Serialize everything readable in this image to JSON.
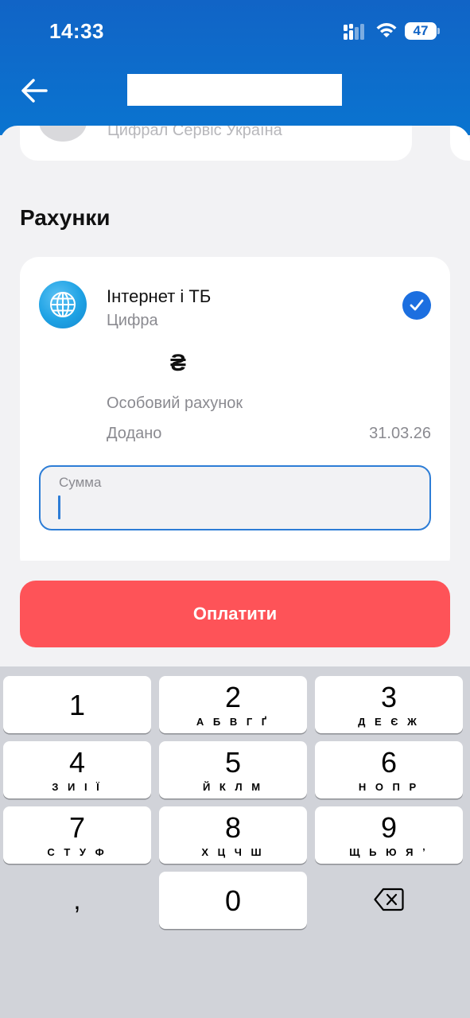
{
  "status_bar": {
    "time": "14:33",
    "battery": "47"
  },
  "sheet": {
    "top_provider": "Цифрал Сервіс Україна",
    "section_title": "Рахунки"
  },
  "account": {
    "service_name": "Інтернет і ТБ",
    "provider": "Цифра",
    "currency_symbol": "₴",
    "account_label": "Особовий рахунок",
    "added_label": "Додано",
    "added_date": "31.03.26",
    "amount_label": "Сумма",
    "amount_value": "",
    "selected": true
  },
  "pay_button": {
    "label": "Оплатити"
  },
  "keyboard": {
    "keys": [
      {
        "num": "1",
        "letters": ""
      },
      {
        "num": "2",
        "letters": "А Б В Г Ґ"
      },
      {
        "num": "3",
        "letters": "Д Е Є Ж"
      },
      {
        "num": "4",
        "letters": "З И І Ї"
      },
      {
        "num": "5",
        "letters": "Й К Л М"
      },
      {
        "num": "6",
        "letters": "Н О П Р"
      },
      {
        "num": "7",
        "letters": "С Т У Ф"
      },
      {
        "num": "8",
        "letters": "Х Ц Ч Ш"
      },
      {
        "num": "9",
        "letters": "Щ Ь Ю Я ʼ"
      },
      {
        "num": "0",
        "letters": ""
      }
    ],
    "comma": ",",
    "delete_icon": "backspace-icon"
  },
  "colors": {
    "header_blue": "#1164c6",
    "accent_blue": "#1c6fe0",
    "pay_red": "#fe5358",
    "keyboard_bg": "#d1d3d9"
  }
}
